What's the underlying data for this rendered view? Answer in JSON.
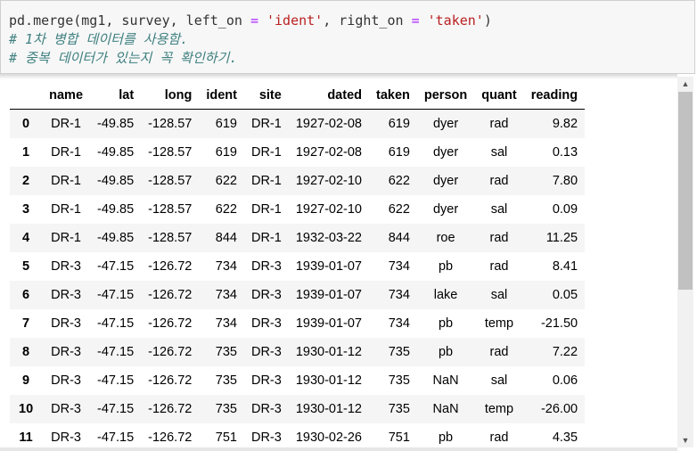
{
  "code_cell": {
    "line1": {
      "prefix": "pd.merge(mg1, survey, left_on ",
      "op1": "=",
      "str1": "'ident'",
      "mid": ", right_on ",
      "op2": "=",
      "str2": "'taken'",
      "suffix": ")"
    },
    "line2": "# 1차 병합 데이터를 사용함.",
    "line3": "# 중복 데이터가 있는지 꼭 확인하기."
  },
  "table": {
    "columns": [
      "name",
      "lat",
      "long",
      "ident",
      "site",
      "dated",
      "taken",
      "person",
      "quant",
      "reading"
    ],
    "rows": [
      {
        "index": "0",
        "name": "DR-1",
        "lat": "-49.85",
        "long": "-128.57",
        "ident": "619",
        "site": "DR-1",
        "dated": "1927-02-08",
        "taken": "619",
        "person": "dyer",
        "quant": "rad",
        "reading": "9.82"
      },
      {
        "index": "1",
        "name": "DR-1",
        "lat": "-49.85",
        "long": "-128.57",
        "ident": "619",
        "site": "DR-1",
        "dated": "1927-02-08",
        "taken": "619",
        "person": "dyer",
        "quant": "sal",
        "reading": "0.13"
      },
      {
        "index": "2",
        "name": "DR-1",
        "lat": "-49.85",
        "long": "-128.57",
        "ident": "622",
        "site": "DR-1",
        "dated": "1927-02-10",
        "taken": "622",
        "person": "dyer",
        "quant": "rad",
        "reading": "7.80"
      },
      {
        "index": "3",
        "name": "DR-1",
        "lat": "-49.85",
        "long": "-128.57",
        "ident": "622",
        "site": "DR-1",
        "dated": "1927-02-10",
        "taken": "622",
        "person": "dyer",
        "quant": "sal",
        "reading": "0.09"
      },
      {
        "index": "4",
        "name": "DR-1",
        "lat": "-49.85",
        "long": "-128.57",
        "ident": "844",
        "site": "DR-1",
        "dated": "1932-03-22",
        "taken": "844",
        "person": "roe",
        "quant": "rad",
        "reading": "11.25"
      },
      {
        "index": "5",
        "name": "DR-3",
        "lat": "-47.15",
        "long": "-126.72",
        "ident": "734",
        "site": "DR-3",
        "dated": "1939-01-07",
        "taken": "734",
        "person": "pb",
        "quant": "rad",
        "reading": "8.41"
      },
      {
        "index": "6",
        "name": "DR-3",
        "lat": "-47.15",
        "long": "-126.72",
        "ident": "734",
        "site": "DR-3",
        "dated": "1939-01-07",
        "taken": "734",
        "person": "lake",
        "quant": "sal",
        "reading": "0.05"
      },
      {
        "index": "7",
        "name": "DR-3",
        "lat": "-47.15",
        "long": "-126.72",
        "ident": "734",
        "site": "DR-3",
        "dated": "1939-01-07",
        "taken": "734",
        "person": "pb",
        "quant": "temp",
        "reading": "-21.50"
      },
      {
        "index": "8",
        "name": "DR-3",
        "lat": "-47.15",
        "long": "-126.72",
        "ident": "735",
        "site": "DR-3",
        "dated": "1930-01-12",
        "taken": "735",
        "person": "pb",
        "quant": "rad",
        "reading": "7.22"
      },
      {
        "index": "9",
        "name": "DR-3",
        "lat": "-47.15",
        "long": "-126.72",
        "ident": "735",
        "site": "DR-3",
        "dated": "1930-01-12",
        "taken": "735",
        "person": "NaN",
        "quant": "sal",
        "reading": "0.06"
      },
      {
        "index": "10",
        "name": "DR-3",
        "lat": "-47.15",
        "long": "-126.72",
        "ident": "735",
        "site": "DR-3",
        "dated": "1930-01-12",
        "taken": "735",
        "person": "NaN",
        "quant": "temp",
        "reading": "-26.00"
      },
      {
        "index": "11",
        "name": "DR-3",
        "lat": "-47.15",
        "long": "-126.72",
        "ident": "751",
        "site": "DR-3",
        "dated": "1930-02-26",
        "taken": "751",
        "person": "pb",
        "quant": "rad",
        "reading": "4.35"
      }
    ]
  },
  "scrollbar": {
    "up_icon": "triangle-up",
    "down_icon": "triangle-down"
  }
}
